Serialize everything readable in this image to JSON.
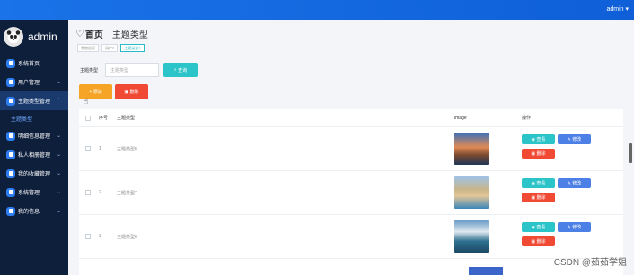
{
  "topbar": {
    "user": "admin ▾"
  },
  "sidebar": {
    "brand": "admin",
    "items": [
      {
        "label": "系统首页",
        "chev": "",
        "active": false
      },
      {
        "label": "用户管理",
        "chev": "⌄",
        "active": false
      },
      {
        "label": "主题类型管理",
        "chev": "⌃",
        "active": true
      },
      {
        "label": "明细信息管理",
        "chev": "⌄",
        "active": false
      },
      {
        "label": "私人相册管理",
        "chev": "⌄",
        "active": false
      },
      {
        "label": "我的收藏管理",
        "chev": "⌄",
        "active": false
      },
      {
        "label": "系统管理",
        "chev": "⌄",
        "active": false
      },
      {
        "label": "我的信息",
        "chev": "⌄",
        "active": false
      }
    ],
    "sub_item": "主题类型"
  },
  "header": {
    "home": "首页",
    "page_title": "主题类型"
  },
  "breadcrumbs": [
    "系统首页",
    "用户× ",
    "主题类型×"
  ],
  "search": {
    "label": "主题类型",
    "placeholder": "主题类型",
    "button": "查询"
  },
  "actions": {
    "add": "+ 添加",
    "delete": "删除"
  },
  "table": {
    "headers": {
      "index": "序号",
      "name": "主题类型",
      "image": "image",
      "ops": "操作"
    },
    "rows": [
      {
        "index": "1",
        "name": "主题类型8"
      },
      {
        "index": "2",
        "name": "主题类型7"
      },
      {
        "index": "3",
        "name": "主题类型6"
      }
    ],
    "ops": {
      "view": "查看",
      "edit": "修改",
      "delete": "删除"
    }
  },
  "watermark": "CSDN @茹茹学姐",
  "colors": {
    "topbar": "#1a73e8",
    "sidebar": "#0e1f3c",
    "teal": "#2bc4c8",
    "orange": "#f5a425",
    "red": "#f04a35",
    "blue": "#4d80e6"
  }
}
